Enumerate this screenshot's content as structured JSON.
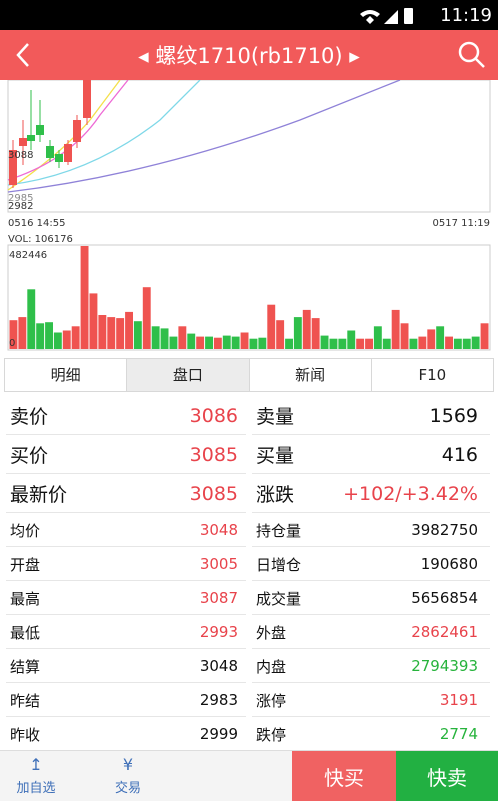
{
  "status_bar": {
    "time": "11:19"
  },
  "header": {
    "title": "◂ 螺纹1710(rb1710) ▸"
  },
  "chart": {
    "price_high_label": "3088",
    "price_low_label": "2982",
    "price_low_label2": "2985",
    "time_start": "0516 14:55",
    "time_end": "0517 11:19",
    "vol_label": "VOL: 106176",
    "vol_max_label": "482446",
    "vol_zero_label": "0",
    "colors": {
      "up": "#ef5350",
      "down": "#2fbf4a"
    }
  },
  "chart_data": {
    "type": "bar",
    "volumes": [
      {
        "v": 0.28,
        "up": true
      },
      {
        "v": 0.31,
        "up": true
      },
      {
        "v": 0.58,
        "up": false
      },
      {
        "v": 0.25,
        "up": false
      },
      {
        "v": 0.26,
        "up": false
      },
      {
        "v": 0.16,
        "up": false
      },
      {
        "v": 0.18,
        "up": true
      },
      {
        "v": 0.22,
        "up": true
      },
      {
        "v": 1.0,
        "up": true
      },
      {
        "v": 0.54,
        "up": true
      },
      {
        "v": 0.33,
        "up": true
      },
      {
        "v": 0.31,
        "up": true
      },
      {
        "v": 0.3,
        "up": true
      },
      {
        "v": 0.36,
        "up": true
      },
      {
        "v": 0.27,
        "up": false
      },
      {
        "v": 0.6,
        "up": true
      },
      {
        "v": 0.22,
        "up": false
      },
      {
        "v": 0.2,
        "up": false
      },
      {
        "v": 0.12,
        "up": false
      },
      {
        "v": 0.22,
        "up": true
      },
      {
        "v": 0.15,
        "up": false
      },
      {
        "v": 0.12,
        "up": true
      },
      {
        "v": 0.12,
        "up": false
      },
      {
        "v": 0.11,
        "up": true
      },
      {
        "v": 0.13,
        "up": false
      },
      {
        "v": 0.12,
        "up": false
      },
      {
        "v": 0.16,
        "up": true
      },
      {
        "v": 0.1,
        "up": false
      },
      {
        "v": 0.11,
        "up": false
      },
      {
        "v": 0.43,
        "up": true
      },
      {
        "v": 0.28,
        "up": true
      },
      {
        "v": 0.1,
        "up": false
      },
      {
        "v": 0.31,
        "up": false
      },
      {
        "v": 0.38,
        "up": true
      },
      {
        "v": 0.3,
        "up": true
      },
      {
        "v": 0.13,
        "up": false
      },
      {
        "v": 0.1,
        "up": false
      },
      {
        "v": 0.1,
        "up": false
      },
      {
        "v": 0.18,
        "up": false
      },
      {
        "v": 0.1,
        "up": true
      },
      {
        "v": 0.1,
        "up": true
      },
      {
        "v": 0.22,
        "up": false
      },
      {
        "v": 0.1,
        "up": false
      },
      {
        "v": 0.38,
        "up": true
      },
      {
        "v": 0.25,
        "up": true
      },
      {
        "v": 0.1,
        "up": false
      },
      {
        "v": 0.12,
        "up": true
      },
      {
        "v": 0.19,
        "up": true
      },
      {
        "v": 0.22,
        "up": false
      },
      {
        "v": 0.12,
        "up": true
      },
      {
        "v": 0.1,
        "up": false
      },
      {
        "v": 0.1,
        "up": false
      },
      {
        "v": 0.12,
        "up": false
      },
      {
        "v": 0.25,
        "up": true
      }
    ]
  },
  "tabs": [
    "明细",
    "盘口",
    "新闻",
    "F10"
  ],
  "quotes": {
    "big": [
      {
        "l_label": "卖价",
        "l_val": "3086",
        "l_color": "red",
        "r_label": "卖量",
        "r_val": "1569",
        "r_color": "black"
      },
      {
        "l_label": "买价",
        "l_val": "3085",
        "l_color": "red",
        "r_label": "买量",
        "r_val": "416",
        "r_color": "black"
      },
      {
        "l_label": "最新价",
        "l_val": "3085",
        "l_color": "red",
        "r_label": "涨跌",
        "r_val": "+102/+3.42%",
        "r_color": "red"
      }
    ],
    "small": [
      {
        "l_label": "均价",
        "l_val": "3048",
        "l_color": "red",
        "r_label": "持仓量",
        "r_val": "3982750",
        "r_color": "black"
      },
      {
        "l_label": "开盘",
        "l_val": "3005",
        "l_color": "red",
        "r_label": "日增仓",
        "r_val": "190680",
        "r_color": "black"
      },
      {
        "l_label": "最高",
        "l_val": "3087",
        "l_color": "red",
        "r_label": "成交量",
        "r_val": "5656854",
        "r_color": "black"
      },
      {
        "l_label": "最低",
        "l_val": "2993",
        "l_color": "red",
        "r_label": "外盘",
        "r_val": "2862461",
        "r_color": "red"
      },
      {
        "l_label": "结算",
        "l_val": "3048",
        "l_color": "black",
        "r_label": "内盘",
        "r_val": "2794393",
        "r_color": "green"
      },
      {
        "l_label": "昨结",
        "l_val": "2983",
        "l_color": "black",
        "r_label": "涨停",
        "r_val": "3191",
        "r_color": "red"
      },
      {
        "l_label": "昨收",
        "l_val": "2999",
        "l_color": "black",
        "r_label": "跌停",
        "r_val": "2774",
        "r_color": "green"
      }
    ]
  },
  "bottom_bar": {
    "add_watch_label": "加自选",
    "add_watch_icon": "↥",
    "trade_label": "交易",
    "trade_icon": "¥",
    "buy_label": "快买",
    "sell_label": "快卖"
  }
}
